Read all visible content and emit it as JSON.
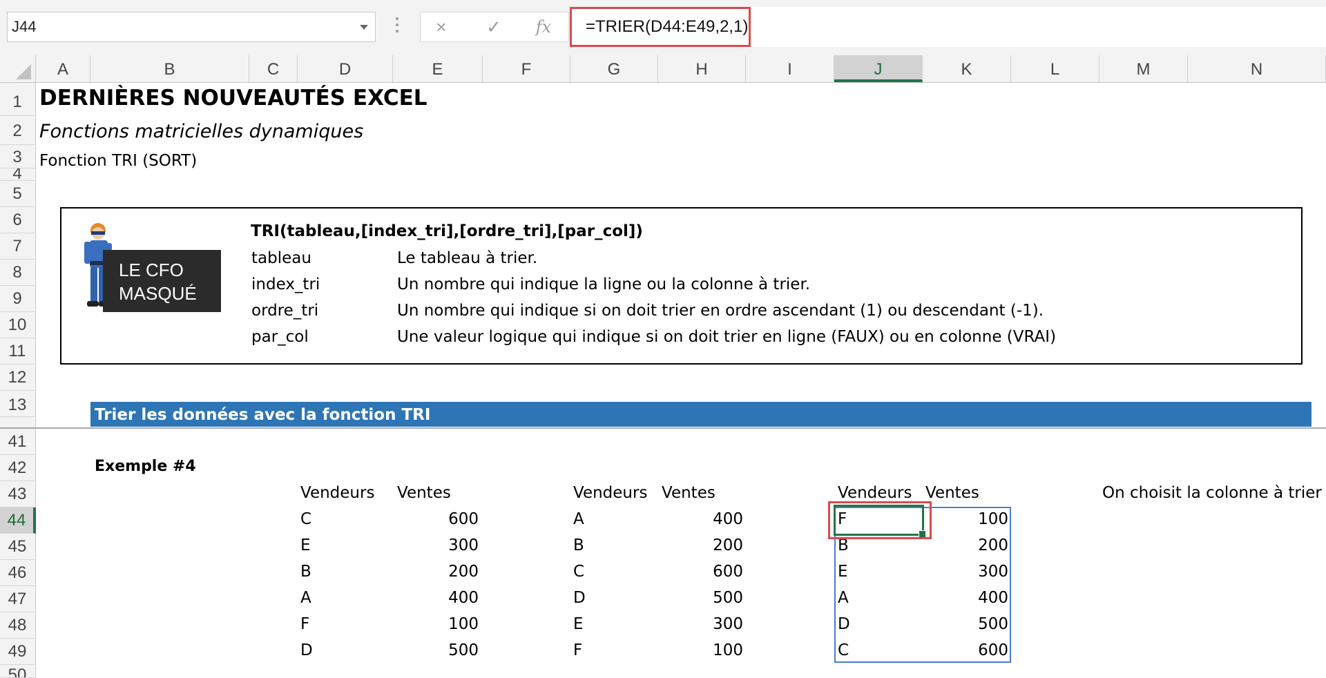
{
  "formula_bar": {
    "name_box": "J44",
    "cancel_icon": "×",
    "enter_icon": "✓",
    "fx_label": "fx",
    "formula": "=TRIER(D44:E49,2,1)"
  },
  "columns": [
    "A",
    "B",
    "C",
    "D",
    "E",
    "F",
    "G",
    "H",
    "I",
    "J",
    "K",
    "L",
    "M",
    "N"
  ],
  "selected_column": "J",
  "rows": [
    "1",
    "2",
    "3",
    "4",
    "5",
    "6",
    "7",
    "8",
    "9",
    "10",
    "11",
    "12",
    "13",
    "41",
    "42",
    "43",
    "44",
    "45",
    "46",
    "47",
    "48",
    "49",
    "50"
  ],
  "selected_row": "44",
  "sheet": {
    "title": "DERNIÈRES NOUVEAUTÉS EXCEL",
    "subtitle": "Fonctions matricielles dynamiques",
    "function_name": "Fonction TRI (SORT)",
    "logo": {
      "line1": "LE CFO",
      "line2": "MASQUÉ"
    },
    "syntax": "TRI(tableau,[index_tri],[ordre_tri],[par_col])",
    "args": [
      {
        "name": "tableau",
        "desc": "Le tableau à trier."
      },
      {
        "name": "index_tri",
        "desc": "Un nombre qui indique la ligne ou la colonne à trier."
      },
      {
        "name": "ordre_tri",
        "desc": "Un nombre qui indique si on doit trier en ordre ascendant (1) ou descendant (-1)."
      },
      {
        "name": "par_col",
        "desc": "Une valeur logique qui indique si on doit trier en ligne (FAUX) ou en colonne (VRAI)"
      }
    ],
    "section_title": "Trier les données avec la fonction TRI",
    "example_label": "Exemple #4",
    "note": "On choisit la colonne à trier",
    "tables": [
      {
        "headers": [
          "Vendeurs",
          "Ventes"
        ],
        "rows": [
          [
            "C",
            "600"
          ],
          [
            "E",
            "300"
          ],
          [
            "B",
            "200"
          ],
          [
            "A",
            "400"
          ],
          [
            "F",
            "100"
          ],
          [
            "D",
            "500"
          ]
        ]
      },
      {
        "headers": [
          "Vendeurs",
          "Ventes"
        ],
        "rows": [
          [
            "A",
            "400"
          ],
          [
            "B",
            "200"
          ],
          [
            "C",
            "600"
          ],
          [
            "D",
            "500"
          ],
          [
            "E",
            "300"
          ],
          [
            "F",
            "100"
          ]
        ]
      },
      {
        "headers": [
          "Vendeurs",
          "Ventes"
        ],
        "rows": [
          [
            "F",
            "100"
          ],
          [
            "B",
            "200"
          ],
          [
            "E",
            "300"
          ],
          [
            "A",
            "400"
          ],
          [
            "D",
            "500"
          ],
          [
            "C",
            "600"
          ]
        ]
      }
    ]
  }
}
